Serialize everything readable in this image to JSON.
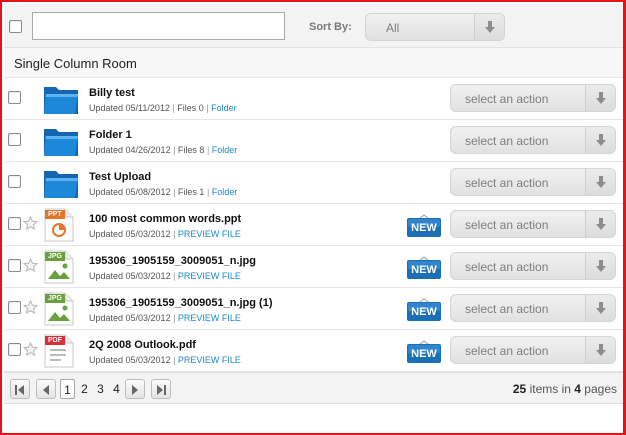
{
  "toolbar": {
    "search_value": "",
    "sort_label": "Sort By:",
    "sort_value": "All"
  },
  "room": {
    "title": "Single Column Room"
  },
  "items": [
    {
      "name": "Billy test",
      "kind": "folder",
      "updated": "Updated 05/11/2012",
      "files": "Files 0",
      "link": "Folder",
      "new": false
    },
    {
      "name": "Folder 1",
      "kind": "folder",
      "updated": "Updated 04/26/2012",
      "files": "Files 8",
      "link": "Folder",
      "new": false
    },
    {
      "name": "Test Upload",
      "kind": "folder",
      "updated": "Updated 05/08/2012",
      "files": "Files 1",
      "link": "Folder",
      "new": false
    },
    {
      "name": "100 most common words.ppt",
      "kind": "ppt",
      "badge": "PPT",
      "updated": "Updated 05/03/2012",
      "link": "PREVIEW FILE",
      "new": true
    },
    {
      "name": "195306_1905159_3009051_n.jpg",
      "kind": "jpg",
      "badge": "JPG",
      "updated": "Updated 05/03/2012",
      "link": "PREVIEW FILE",
      "new": true
    },
    {
      "name": "195306_1905159_3009051_n.jpg (1)",
      "kind": "jpg",
      "badge": "JPG",
      "updated": "Updated 05/03/2012",
      "link": "PREVIEW FILE",
      "new": true
    },
    {
      "name": "2Q 2008 Outlook.pdf",
      "kind": "pdf",
      "badge": "PDF",
      "updated": "Updated 05/03/2012",
      "link": "PREVIEW FILE",
      "new": true
    }
  ],
  "action_label": "select an action",
  "new_label": "NEW",
  "pager": {
    "pages": [
      "1",
      "2",
      "3",
      "4"
    ],
    "current": "1",
    "total_items": "25",
    "items_in": "items in",
    "total_pages": "4",
    "pages_word": "pages"
  },
  "colors": {
    "frame": "#e0141a",
    "folder": "#1e88d8",
    "ppt": "#e2762e",
    "jpg": "#6aa13d",
    "pdf": "#d6303a",
    "link": "#1a8ac9",
    "new_badge": "#1a6fb5"
  }
}
